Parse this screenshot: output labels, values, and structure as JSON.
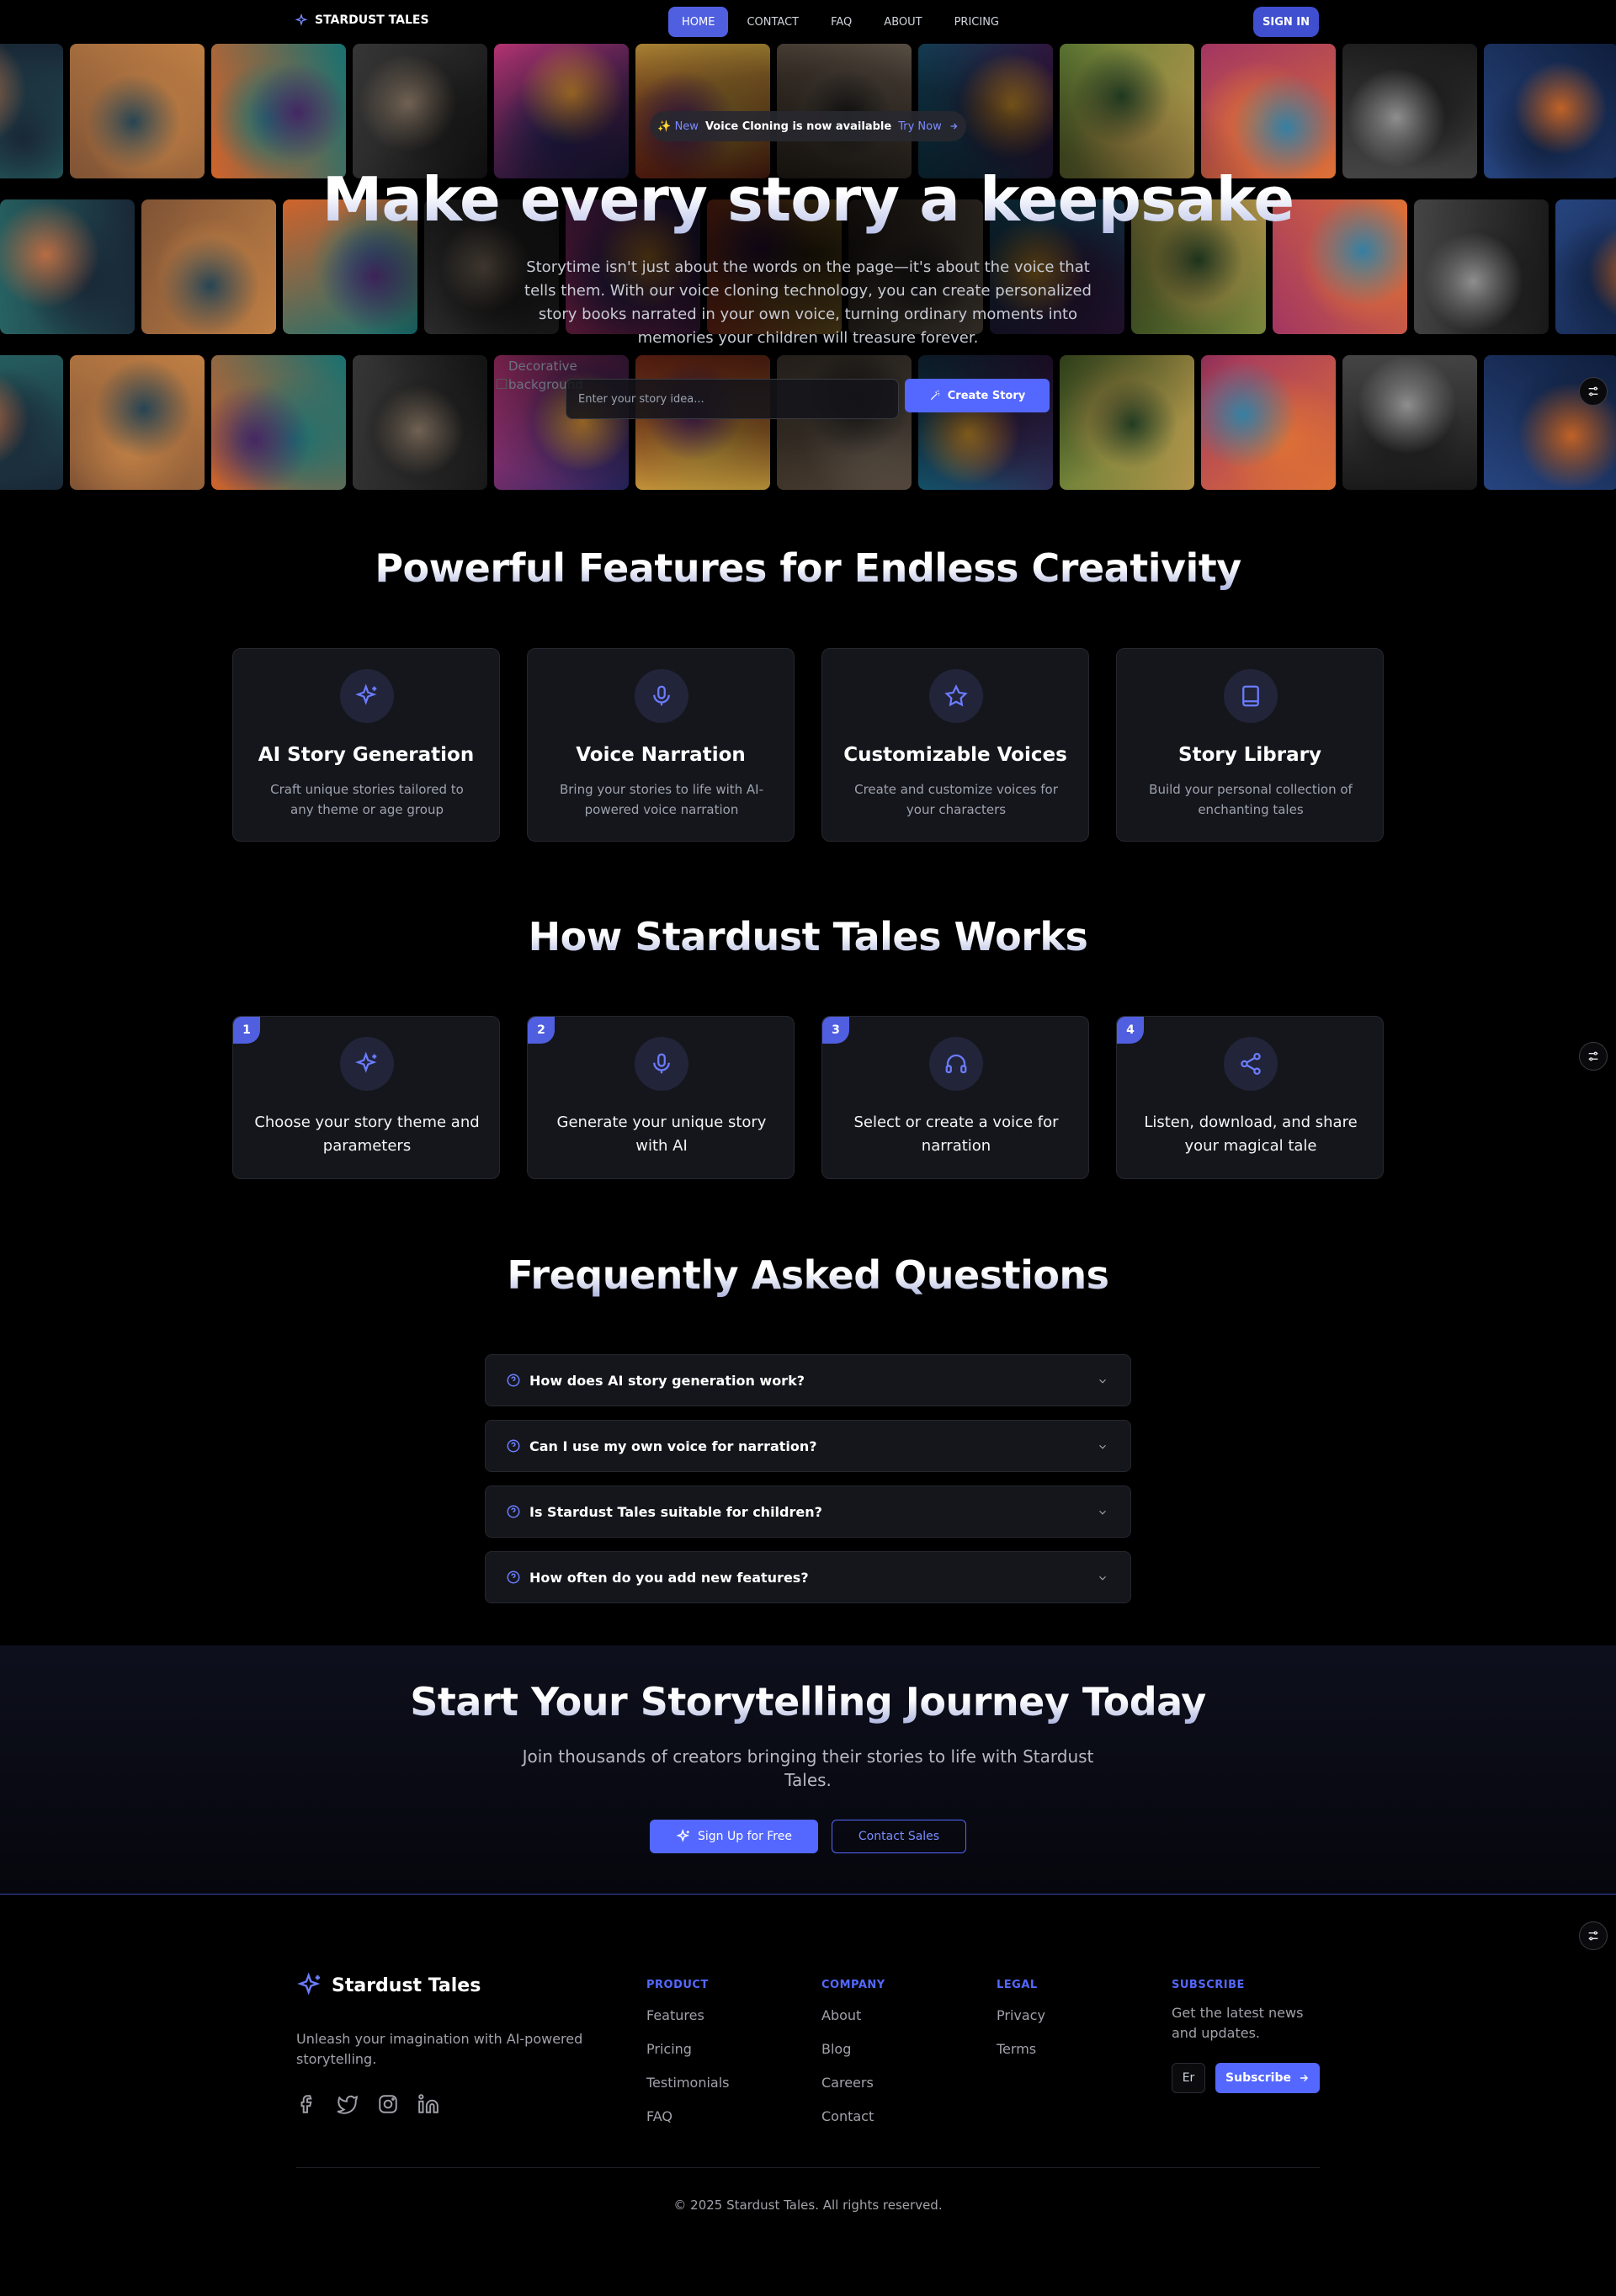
{
  "nav": {
    "brand": "STARDUST TALES",
    "links": [
      "HOME",
      "CONTACT",
      "FAQ",
      "ABOUT",
      "PRICING"
    ],
    "signin": "SIGN IN"
  },
  "hero": {
    "pill_new": "✨ New",
    "pill_message": "Voice Cloning is now available",
    "pill_try": "Try Now",
    "title": "Make every story a keepsake",
    "subtitle": "Storytime isn't just about the words on the page—it's about the voice that tells them. With our voice cloning technology, you can create personalized story books narrated in your own voice, turning ordinary moments into memories your children will treasure forever.",
    "decorative_alt": "Decorative background",
    "input_placeholder": "Enter your story idea...",
    "create_button": "Create Story"
  },
  "features": {
    "title": "Powerful Features for Endless Creativity",
    "items": [
      {
        "title": "AI Story Generation",
        "desc": "Craft unique stories tailored to any theme or age group",
        "icon": "sparkles-icon"
      },
      {
        "title": "Voice Narration",
        "desc": "Bring your stories to life with AI-powered voice narration",
        "icon": "microphone-icon"
      },
      {
        "title": "Customizable Voices",
        "desc": "Create and customize voices for your characters",
        "icon": "star-icon"
      },
      {
        "title": "Story Library",
        "desc": "Build your personal collection of enchanting tales",
        "icon": "book-icon"
      }
    ]
  },
  "how": {
    "title": "How Stardust Tales Works",
    "steps": [
      {
        "num": "1",
        "text": "Choose your story theme and parameters",
        "icon": "sparkles-icon"
      },
      {
        "num": "2",
        "text": "Generate your unique story with AI",
        "icon": "microphone-icon"
      },
      {
        "num": "3",
        "text": "Select or create a voice for narration",
        "icon": "headphones-icon"
      },
      {
        "num": "4",
        "text": "Listen, download, and share your magical tale",
        "icon": "share-icon"
      }
    ]
  },
  "faq": {
    "title": "Frequently Asked Questions",
    "items": [
      "How does AI story generation work?",
      "Can I use my own voice for narration?",
      "Is Stardust Tales suitable for children?",
      "How often do you add new features?"
    ]
  },
  "cta": {
    "title": "Start Your Storytelling Journey Today",
    "subtitle": "Join thousands of creators bringing their stories to life with Stardust Tales.",
    "primary": "Sign Up for Free",
    "secondary": "Contact Sales"
  },
  "footer": {
    "brand": "Stardust Tales",
    "tagline": "Unleash your imagination with AI-powered storytelling.",
    "product": {
      "heading": "PRODUCT",
      "links": [
        "Features",
        "Pricing",
        "Testimonials",
        "FAQ"
      ]
    },
    "company": {
      "heading": "COMPANY",
      "links": [
        "About",
        "Blog",
        "Careers",
        "Contact"
      ]
    },
    "legal": {
      "heading": "LEGAL",
      "links": [
        "Privacy",
        "Terms"
      ]
    },
    "subscribe": {
      "heading": "SUBSCRIBE",
      "text": "Get the latest news and updates.",
      "email_value": "Er",
      "button": "Subscribe"
    },
    "copyright": "© 2025 Stardust Tales. All rights reserved."
  },
  "colors": {
    "accent": "#5468ff",
    "background": "#000000",
    "card": "#15161b"
  }
}
